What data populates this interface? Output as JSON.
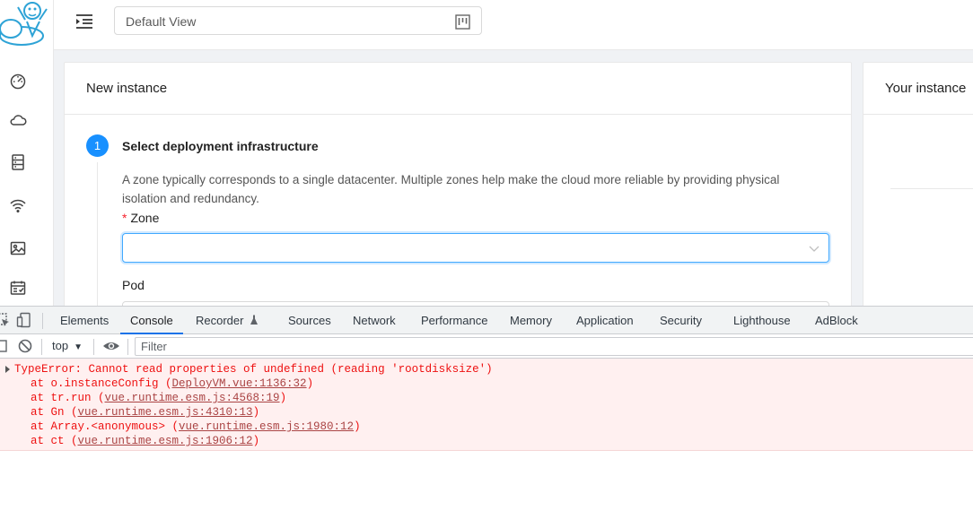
{
  "header": {
    "view_select_value": "Default View"
  },
  "sidebar": {
    "items": [
      {
        "icon": "dashboard-icon"
      },
      {
        "icon": "cloud-icon"
      },
      {
        "icon": "storage-icon"
      },
      {
        "icon": "network-icon"
      },
      {
        "icon": "image-icon"
      },
      {
        "icon": "events-icon"
      }
    ]
  },
  "new_instance": {
    "title": "New instance",
    "step_number": "1",
    "step_title": "Select deployment infrastructure",
    "step_description": "A zone typically corresponds to a single datacenter. Multiple zones help make the cloud more reliable by providing physical isolation and redundancy.",
    "zone_required_mark": "*",
    "zone_label": "Zone",
    "zone_value": "",
    "pod_label": "Pod"
  },
  "your_instance": {
    "title": "Your instance"
  },
  "devtools": {
    "tabs": [
      "Elements",
      "Console",
      "Recorder",
      "Sources",
      "Network",
      "Performance",
      "Memory",
      "Application",
      "Security",
      "Lighthouse",
      "AdBlock"
    ],
    "active_tab": "Console",
    "context": "top",
    "filter_placeholder": "Filter",
    "error": {
      "message": "TypeError: Cannot read properties of undefined (reading 'rootdisksize')",
      "frames": [
        {
          "prefix": "at o.instanceConfig (",
          "link": "DeployVM.vue:1136:32",
          "suffix": ")"
        },
        {
          "prefix": "at tr.run (",
          "link": "vue.runtime.esm.js:4568:19",
          "suffix": ")"
        },
        {
          "prefix": "at Gn (",
          "link": "vue.runtime.esm.js:4310:13",
          "suffix": ")"
        },
        {
          "prefix": "at Array.<anonymous> (",
          "link": "vue.runtime.esm.js:1980:12",
          "suffix": ")"
        },
        {
          "prefix": "at ct (",
          "link": "vue.runtime.esm.js:1906:12",
          "suffix": ")"
        }
      ]
    }
  },
  "colors": {
    "primary": "#1890ff",
    "error_text": "#ee1111",
    "error_bg": "#fff0f0"
  }
}
